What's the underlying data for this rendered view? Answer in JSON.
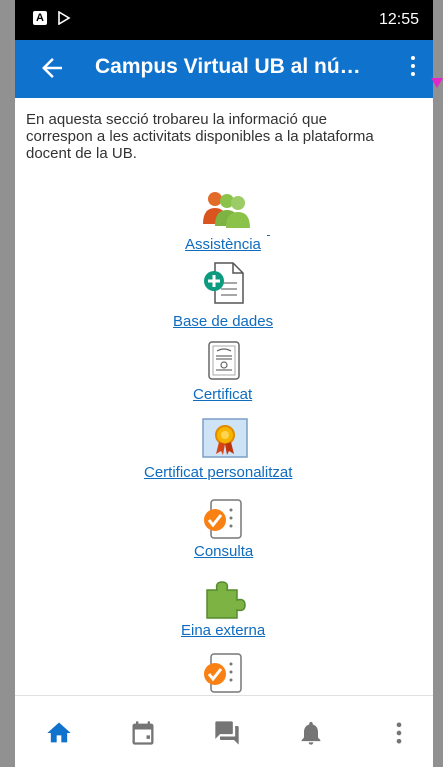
{
  "status_bar": {
    "time": "12:55",
    "notif_icon_letter": "A"
  },
  "app_bar": {
    "title": "Campus Virtual UB al nú…"
  },
  "intro_text": "En aquesta secció trobareu la informació que correspon a les activitats disponibles a la plataforma docent de la UB.",
  "modules": [
    {
      "label": "Assistència",
      "icon": "attendance-icon"
    },
    {
      "label": "Base de dades",
      "icon": "database-icon"
    },
    {
      "label": "Certificat",
      "icon": "certificate-icon"
    },
    {
      "label": "Certificat personalitzat",
      "icon": "custom-certificate-icon"
    },
    {
      "label": "Consulta",
      "icon": "choice-icon"
    },
    {
      "label": "Eina externa",
      "icon": "external-tool-icon"
    },
    {
      "label": "",
      "icon": "choice-icon"
    }
  ],
  "bottom_nav": [
    "home-icon",
    "calendar-icon",
    "messages-icon",
    "notifications-icon",
    "more-icon"
  ],
  "colors": {
    "primary": "#0f72cd",
    "link": "#0f6cbf",
    "accent_orange": "#f98012",
    "teal": "#0d9b7f"
  }
}
